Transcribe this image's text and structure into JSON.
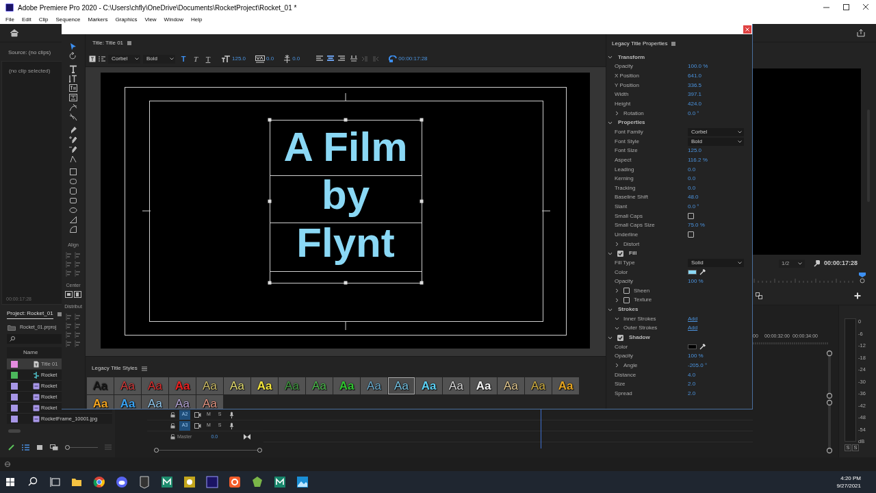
{
  "app": {
    "title": "Adobe Premiere Pro 2020 - C:\\Users\\chfly\\OneDrive\\Documents\\RocketProject\\Rocket_01 *",
    "menu": [
      "File",
      "Edit",
      "Clip",
      "Sequence",
      "Markers",
      "Graphics",
      "View",
      "Window",
      "Help"
    ]
  },
  "source": {
    "tab": "Source: (no clips)",
    "empty": "(no clip selected)",
    "timecode": "00:00:17:28"
  },
  "project": {
    "tab": "Project: Rocket_01",
    "file": "Rocket_01.prproj",
    "column": "Name",
    "zoom": {
      "level": 0
    },
    "items": [
      {
        "name": "Title 01",
        "color": "#e58ce0",
        "kind": "title",
        "selected": true
      },
      {
        "name": "Rocket",
        "color": "#4cb85c",
        "kind": "sequence",
        "selected": false
      },
      {
        "name": "Rocket",
        "color": "#a796e6",
        "kind": "image",
        "selected": false
      },
      {
        "name": "Rocket",
        "color": "#a796e6",
        "kind": "image",
        "selected": false
      },
      {
        "name": "Rocket",
        "color": "#a796e6",
        "kind": "image",
        "selected": false
      },
      {
        "name": "RocketFrame_10001.jpg",
        "color": "#a796e6",
        "kind": "image",
        "selected": false
      }
    ]
  },
  "program": {
    "zoom": "1/2",
    "timecode": "00:00:17:28"
  },
  "timeline": {
    "ruler": [
      "00",
      "00:00:32:00",
      "00:00:34:00"
    ],
    "tracks": [
      {
        "name": "A2",
        "mute": "M",
        "solo": "S"
      },
      {
        "name": "A3",
        "mute": "M",
        "solo": "S"
      }
    ],
    "master": {
      "name": "Master",
      "value": "0.0"
    }
  },
  "meter": {
    "scale": [
      "0",
      "-6",
      "-12",
      "-18",
      "-24",
      "-30",
      "-36",
      "-42",
      "-48",
      "-54",
      "dB"
    ],
    "solo": [
      "S",
      "S"
    ]
  },
  "title_window": {
    "panel": "Title: Title 01",
    "toolbar": {
      "font": "Corbel",
      "style": "Bold",
      "text_styles": [
        {
          "glyph": "T",
          "kind": "bold",
          "selected": true
        },
        {
          "glyph": "T",
          "kind": "italic",
          "selected": false
        },
        {
          "glyph": "T",
          "kind": "underline",
          "selected": false
        }
      ],
      "size": "125.0",
      "kerning": "0.0",
      "leading": "0.0",
      "timecode": "00:00:17:28"
    },
    "text_lines": [
      "A Film",
      "by",
      "Flynt"
    ],
    "tool_groups": [
      "Align",
      "Center",
      "Distribut"
    ]
  },
  "styles": {
    "title": "Legacy Title Styles",
    "swatches": [
      {
        "text": "Aa",
        "color": "#1a1a1a",
        "selected": false
      },
      {
        "text": "Aa",
        "color": "#d23a3a",
        "selected": false
      },
      {
        "text": "Aa",
        "color": "#dc3030",
        "selected": false
      },
      {
        "text": "Aa",
        "color": "#e82020",
        "selected": false
      },
      {
        "text": "Aa",
        "color": "#cbbb66",
        "selected": false
      },
      {
        "text": "Aa",
        "color": "#e6df70",
        "selected": false
      },
      {
        "text": "Aa",
        "color": "#f2e43c",
        "selected": false
      },
      {
        "text": "Aa",
        "color": "#3f9a3f",
        "selected": false
      },
      {
        "text": "Aa",
        "color": "#4cbc4c",
        "selected": false
      },
      {
        "text": "Aa",
        "color": "#30c430",
        "selected": false
      },
      {
        "text": "Aa",
        "color": "#6aaacc",
        "selected": false
      },
      {
        "text": "Aa",
        "color": "#74c2e2",
        "selected": true
      },
      {
        "text": "Aa",
        "color": "#5cd0f4",
        "selected": false
      },
      {
        "text": "Aa",
        "color": "#dcdcdc",
        "selected": false
      },
      {
        "text": "Aa",
        "color": "#f4f4f4",
        "selected": false
      },
      {
        "text": "Aa",
        "color": "#e2c890",
        "selected": false
      },
      {
        "text": "Aa",
        "color": "#d2b042",
        "selected": false
      },
      {
        "text": "Aa",
        "color": "#e4a420",
        "selected": false
      },
      {
        "text": "Aa",
        "color": "#f2a420",
        "selected": false
      },
      {
        "text": "Aa",
        "color": "#3aa2f2",
        "selected": false
      },
      {
        "text": "Aa",
        "color": "#94cbf2",
        "selected": false
      },
      {
        "text": "Aa",
        "color": "#b4a4d4",
        "selected": false
      },
      {
        "text": "Aa",
        "color": "#e29482",
        "selected": false
      }
    ]
  },
  "properties": {
    "title": "Legacy Title Properties",
    "rows": [
      {
        "kind": "section",
        "label": "Transform",
        "expanded": true
      },
      {
        "kind": "field",
        "label": "Opacity",
        "value": "100.0 %"
      },
      {
        "kind": "field",
        "label": "X Position",
        "value": "641.0"
      },
      {
        "kind": "field",
        "label": "Y Position",
        "value": "336.5"
      },
      {
        "kind": "field",
        "label": "Width",
        "value": "397.1"
      },
      {
        "kind": "field",
        "label": "Height",
        "value": "424.0"
      },
      {
        "kind": "group",
        "label": "Rotation",
        "expanded": false,
        "value": "0.0 °"
      },
      {
        "kind": "section",
        "label": "Properties",
        "expanded": true
      },
      {
        "kind": "dropdown",
        "label": "Font Family",
        "value": "Corbel"
      },
      {
        "kind": "dropdown",
        "label": "Font Style",
        "value": "Bold"
      },
      {
        "kind": "field",
        "label": "Font Size",
        "value": "125.0"
      },
      {
        "kind": "field",
        "label": "Aspect",
        "value": "116.2 %"
      },
      {
        "kind": "field",
        "label": "Leading",
        "value": "0.0"
      },
      {
        "kind": "field",
        "label": "Kerning",
        "value": "0.0"
      },
      {
        "kind": "field",
        "label": "Tracking",
        "value": "0.0"
      },
      {
        "kind": "field",
        "label": "Baseline Shift",
        "value": "48.0"
      },
      {
        "kind": "field",
        "label": "Slant",
        "value": "0.0 °"
      },
      {
        "kind": "checkbox",
        "label": "Small Caps",
        "checked": false
      },
      {
        "kind": "field",
        "label": "Small Caps Size",
        "value": "75.0 %"
      },
      {
        "kind": "checkbox",
        "label": "Underline",
        "checked": false
      },
      {
        "kind": "group",
        "label": "Distort",
        "expanded": false
      },
      {
        "kind": "section",
        "label": "Fill",
        "expanded": true,
        "checked": true
      },
      {
        "kind": "dropdown",
        "label": "Fill Type",
        "value": "Solid"
      },
      {
        "kind": "color",
        "label": "Color",
        "color": "#8ad8f5"
      },
      {
        "kind": "field",
        "label": "Opacity",
        "value": "100 %"
      },
      {
        "kind": "group",
        "label": "Sheen",
        "expanded": false,
        "checked": false
      },
      {
        "kind": "group",
        "label": "Texture",
        "expanded": false,
        "checked": false
      },
      {
        "kind": "section",
        "label": "Strokes",
        "expanded": true
      },
      {
        "kind": "group",
        "label": "Inner Strokes",
        "expanded": true,
        "link": "Add"
      },
      {
        "kind": "group",
        "label": "Outer Strokes",
        "expanded": true,
        "link": "Add"
      },
      {
        "kind": "section",
        "label": "Shadow",
        "expanded": true,
        "checked": true
      },
      {
        "kind": "color",
        "label": "Color",
        "color": "#000000"
      },
      {
        "kind": "field",
        "label": "Opacity",
        "value": "100 %"
      },
      {
        "kind": "group",
        "label": "Angle",
        "expanded": false,
        "value": "-205.0 °"
      },
      {
        "kind": "field",
        "label": "Distance",
        "value": "4.0"
      },
      {
        "kind": "field",
        "label": "Size",
        "value": "2.0"
      },
      {
        "kind": "field",
        "label": "Spread",
        "value": "2.0"
      }
    ]
  },
  "taskbar": {
    "time": "4:20 PM",
    "date": "9/27/2021"
  }
}
